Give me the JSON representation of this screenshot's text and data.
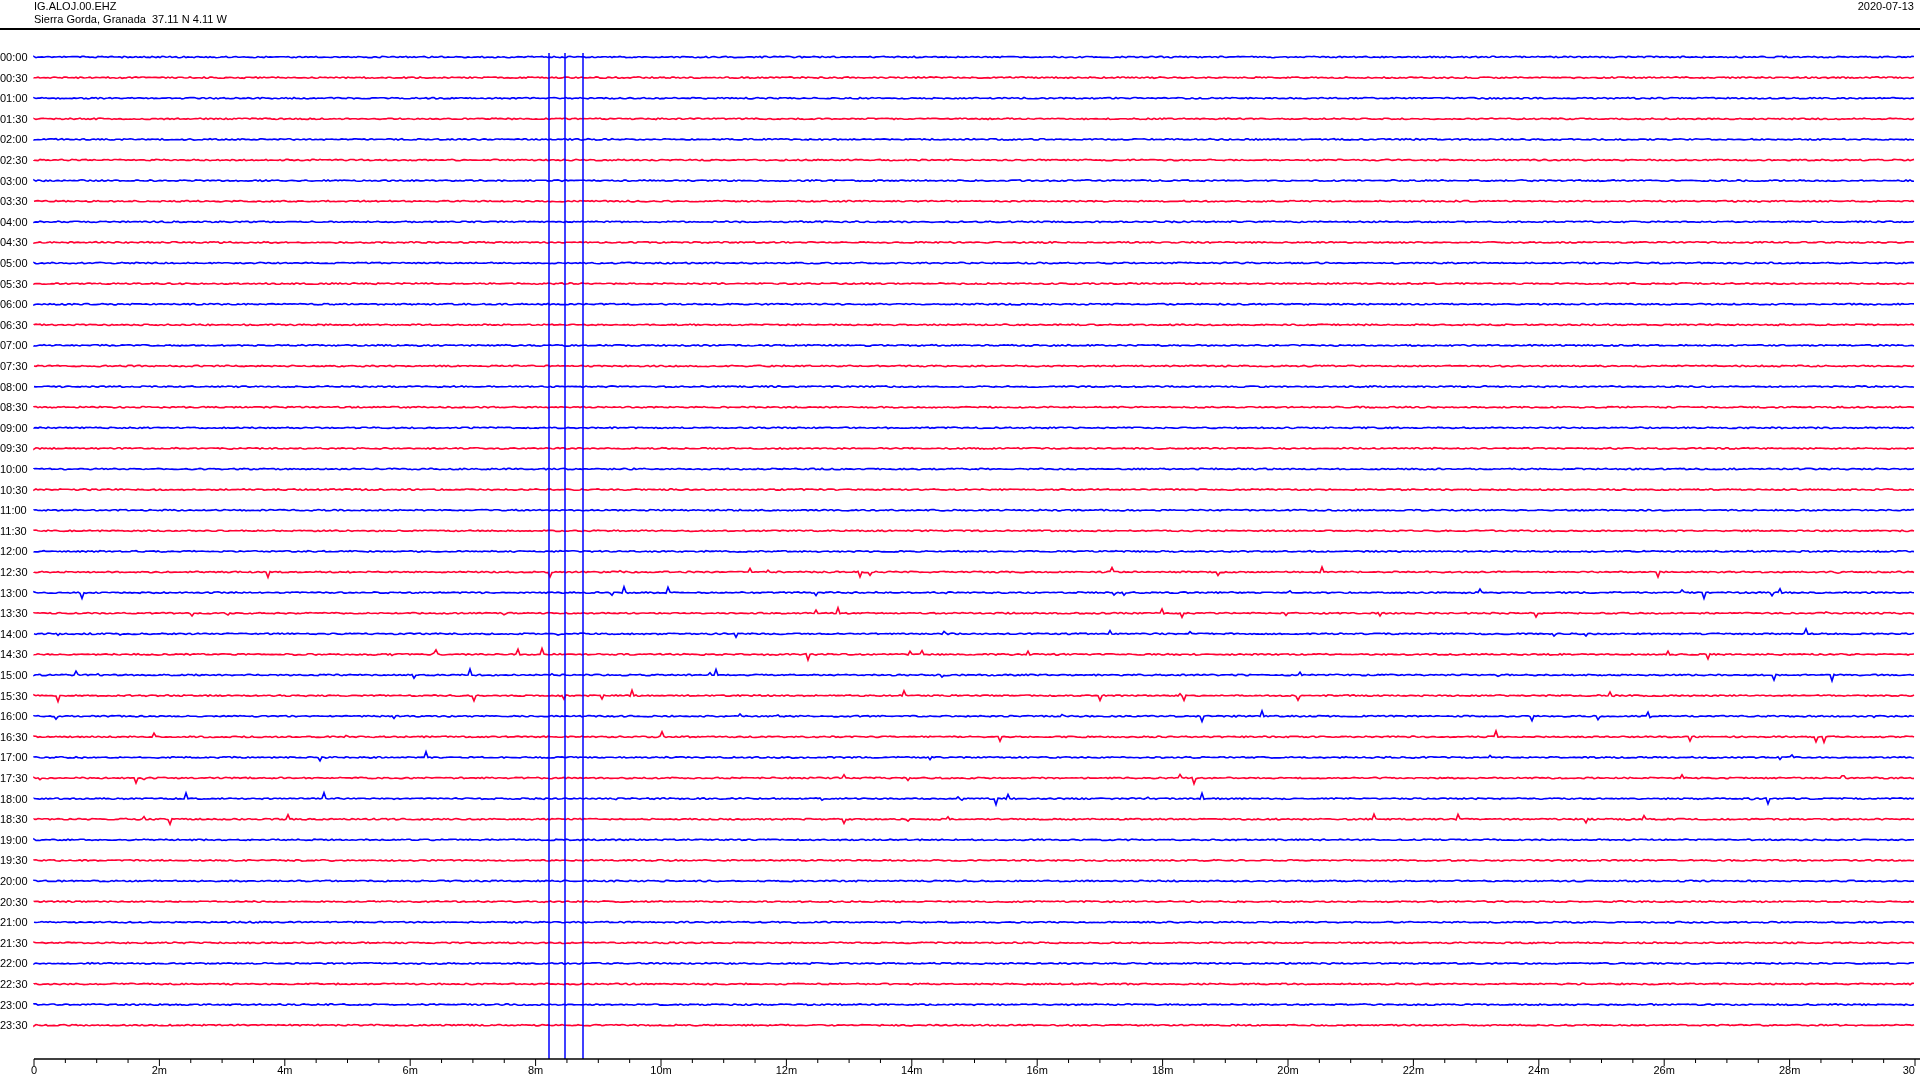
{
  "header": {
    "station": "IG.ALOJ.00.EHZ",
    "location": "Sierra Gorda, Granada  37.11 N 4.11 W",
    "date": "2020-07-13"
  },
  "rows": [
    {
      "time": "00:00",
      "color": "#0000ff"
    },
    {
      "time": "00:30",
      "color": "#ff0033"
    },
    {
      "time": "01:00",
      "color": "#0000ff"
    },
    {
      "time": "01:30",
      "color": "#ff0033"
    },
    {
      "time": "02:00",
      "color": "#0000ff"
    },
    {
      "time": "02:30",
      "color": "#ff0033"
    },
    {
      "time": "03:00",
      "color": "#0000ff"
    },
    {
      "time": "03:30",
      "color": "#ff0033"
    },
    {
      "time": "04:00",
      "color": "#0000ff"
    },
    {
      "time": "04:30",
      "color": "#ff0033"
    },
    {
      "time": "05:00",
      "color": "#0000ff"
    },
    {
      "time": "05:30",
      "color": "#ff0033"
    },
    {
      "time": "06:00",
      "color": "#0000ff"
    },
    {
      "time": "06:30",
      "color": "#ff0033"
    },
    {
      "time": "07:00",
      "color": "#0000ff"
    },
    {
      "time": "07:30",
      "color": "#ff0033"
    },
    {
      "time": "08:00",
      "color": "#0000ff"
    },
    {
      "time": "08:30",
      "color": "#ff0033"
    },
    {
      "time": "09:00",
      "color": "#0000ff"
    },
    {
      "time": "09:30",
      "color": "#ff0033"
    },
    {
      "time": "10:00",
      "color": "#0000ff"
    },
    {
      "time": "10:30",
      "color": "#ff0033"
    },
    {
      "time": "11:00",
      "color": "#0000ff"
    },
    {
      "time": "11:30",
      "color": "#ff0033"
    },
    {
      "time": "12:00",
      "color": "#0000ff"
    },
    {
      "time": "12:30",
      "color": "#ff0033"
    },
    {
      "time": "13:00",
      "color": "#0000ff"
    },
    {
      "time": "13:30",
      "color": "#ff0033"
    },
    {
      "time": "14:00",
      "color": "#0000ff"
    },
    {
      "time": "14:30",
      "color": "#ff0033"
    },
    {
      "time": "15:00",
      "color": "#0000ff"
    },
    {
      "time": "15:30",
      "color": "#ff0033"
    },
    {
      "time": "16:00",
      "color": "#0000ff"
    },
    {
      "time": "16:30",
      "color": "#ff0033"
    },
    {
      "time": "17:00",
      "color": "#0000ff"
    },
    {
      "time": "17:30",
      "color": "#ff0033"
    },
    {
      "time": "18:00",
      "color": "#0000ff"
    },
    {
      "time": "18:30",
      "color": "#ff0033"
    },
    {
      "time": "19:00",
      "color": "#0000ff"
    },
    {
      "time": "19:30",
      "color": "#ff0033"
    },
    {
      "time": "20:00",
      "color": "#0000ff"
    },
    {
      "time": "20:30",
      "color": "#ff0033"
    },
    {
      "time": "21:00",
      "color": "#0000ff"
    },
    {
      "time": "21:30",
      "color": "#ff0033"
    },
    {
      "time": "22:00",
      "color": "#0000ff"
    },
    {
      "time": "22:30",
      "color": "#ff0033"
    },
    {
      "time": "23:00",
      "color": "#0000ff"
    },
    {
      "time": "23:30",
      "color": "#ff0033"
    }
  ],
  "x_axis": {
    "labels": [
      "0",
      "2m",
      "4m",
      "6m",
      "8m",
      "10m",
      "12m",
      "14m",
      "16m",
      "18m",
      "20m",
      "22m",
      "24m",
      "26m",
      "28m",
      "30"
    ]
  }
}
